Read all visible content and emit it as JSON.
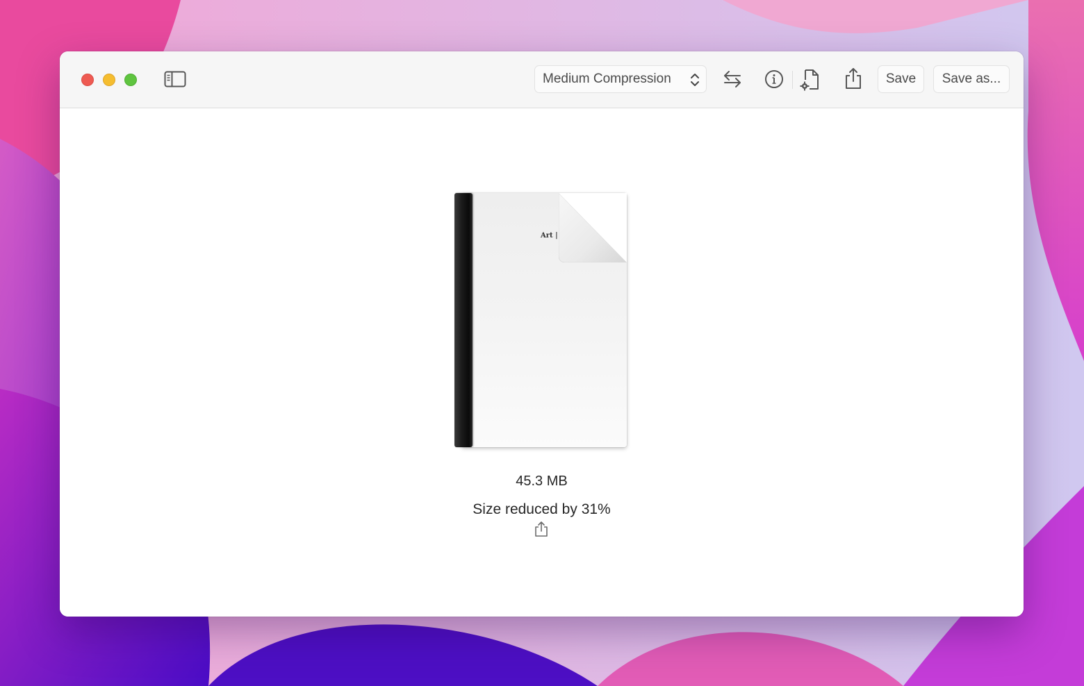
{
  "window": {
    "controls": [
      "close",
      "minimize",
      "zoom"
    ]
  },
  "toolbar": {
    "sidebar_icon": "sidebar-icon",
    "compression": {
      "selected": "Medium Compression",
      "icon": "chevron-up-down-icon"
    },
    "swap_icon": "arrows-swap-icon",
    "info_icon": "info-circle-icon",
    "doc_settings_icon": "document-gear-icon",
    "share_icon": "share-icon",
    "save_label": "Save",
    "save_as_label": "Save as..."
  },
  "document": {
    "thumbnail_title": "Art | ",
    "file_size": "45.3 MB",
    "reduction_text": "Size reduced by 31%",
    "share_icon": "share-icon"
  }
}
